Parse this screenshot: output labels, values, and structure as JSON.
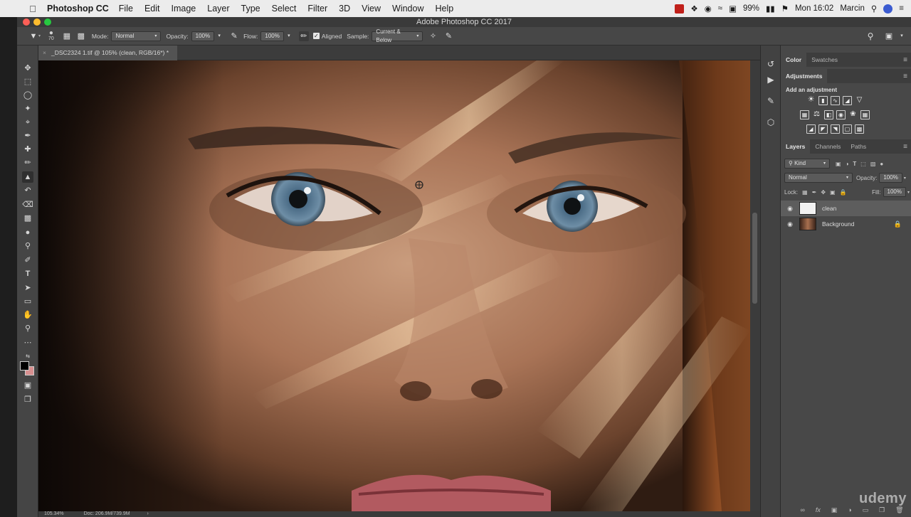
{
  "menubar": {
    "app_name": "Photoshop CC",
    "menus": [
      "File",
      "Edit",
      "Image",
      "Layer",
      "Type",
      "Select",
      "Filter",
      "3D",
      "View",
      "Window",
      "Help"
    ],
    "battery": "99%",
    "clock": "Mon 16:02",
    "user": "Marcin"
  },
  "window": {
    "title": "Adobe Photoshop CC 2017"
  },
  "options": {
    "brush_size": "70",
    "mode_label": "Mode:",
    "mode_value": "Normal",
    "opacity_label": "Opacity:",
    "opacity_value": "100%",
    "flow_label": "Flow:",
    "flow_value": "100%",
    "aligned_label": "Aligned",
    "aligned_checked": true,
    "sample_label": "Sample:",
    "sample_value": "Current & Below"
  },
  "document": {
    "tab_title": "_DSC2324 1.tif @ 105% (clean, RGB/16*) *",
    "close_symbol": "×"
  },
  "status": {
    "zoom": "105.34%",
    "doc_size": "Doc: 206.9M/739.9M"
  },
  "panels": {
    "color_tabs": [
      "Color",
      "Swatches"
    ],
    "adjustments_tab": "Adjustments",
    "adjustments_hint": "Add an adjustment",
    "layers_tabs": [
      "Layers",
      "Channels",
      "Paths"
    ],
    "filter_kind": "Kind",
    "blend_mode": "Normal",
    "opacity_label": "Opacity:",
    "opacity_value": "100%",
    "lock_label": "Lock:",
    "fill_label": "Fill:",
    "fill_value": "100%",
    "layers": [
      {
        "name": "clean",
        "selected": true
      },
      {
        "name": "Background",
        "selected": false,
        "locked": true
      }
    ]
  },
  "watermark": "udemy",
  "colors": {
    "foreground": "#000000",
    "background": "#d89090",
    "accent": "#2d7cf0"
  }
}
